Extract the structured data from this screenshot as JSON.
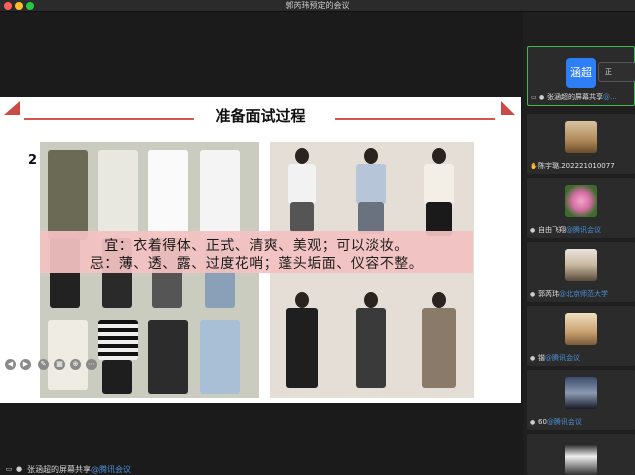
{
  "window": {
    "title": "郭芮玮预定的会议"
  },
  "slide": {
    "title": "准备面试过程",
    "page": "2",
    "banner": {
      "line1": "宜：衣着得体、正式、清爽、美观；可以淡妆。",
      "line2": "忌：薄、透、露、过度花哨；蓬头垢面、仪容不整。"
    },
    "accent_color": "#d9534f"
  },
  "bottombar": {
    "label": "张涵超的屏幕共享",
    "org": "@腾讯会议"
  },
  "participants": [
    {
      "avatar": "涵超",
      "name": "张涵超的屏幕共享",
      "org": "@...",
      "tip": "正"
    },
    {
      "name": "陈宇璐.202221010077",
      "org": ""
    },
    {
      "name": "自由飞翔",
      "org": "@腾讯会议"
    },
    {
      "name": "郭芮玮",
      "org": "@北京师范大学"
    },
    {
      "name": "锴",
      "org": "@腾讯会议"
    },
    {
      "name": "60",
      "org": "@腾讯会议"
    }
  ]
}
